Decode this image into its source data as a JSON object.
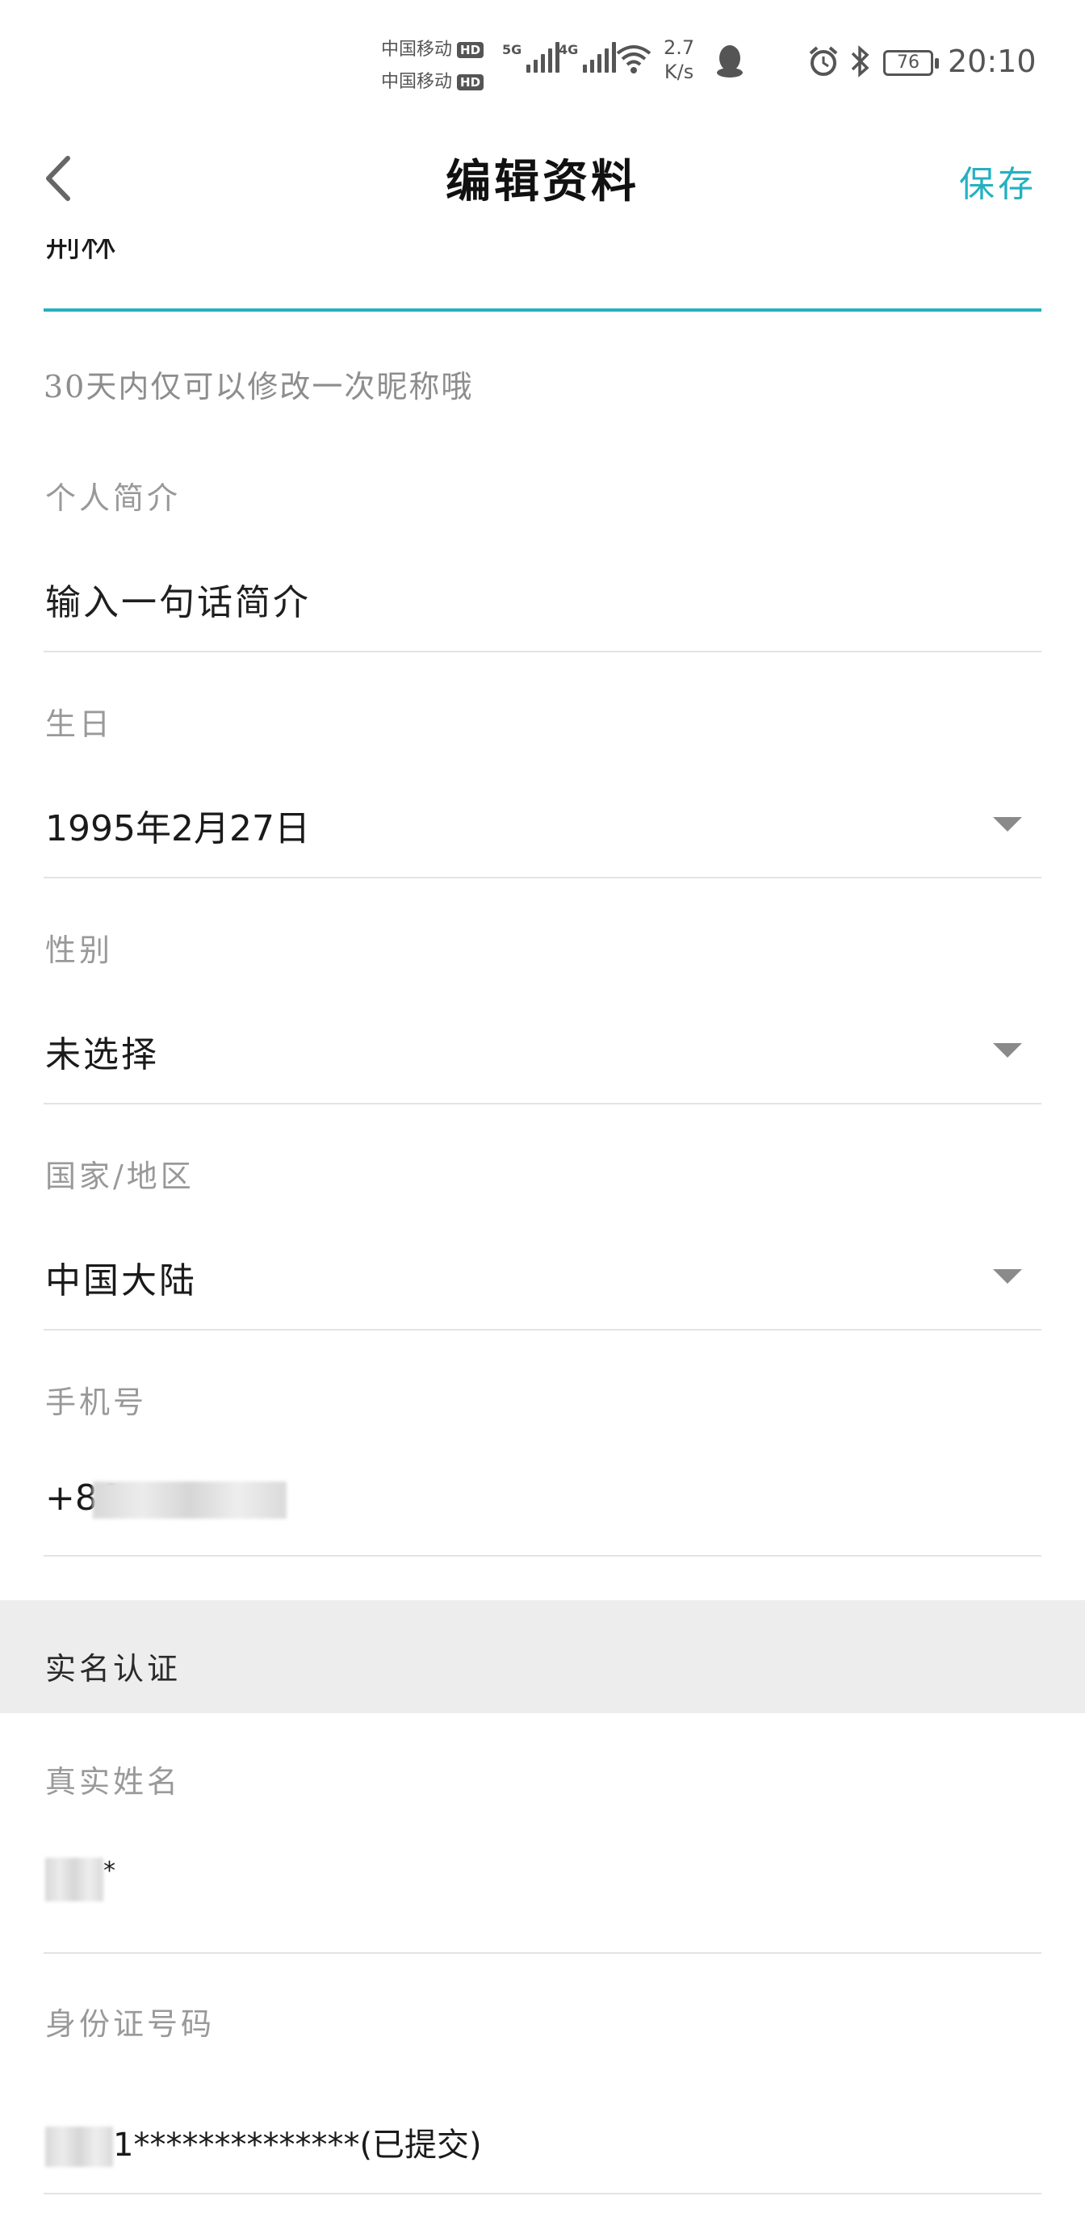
{
  "status_bar": {
    "carrier1": "中国移动",
    "carrier2": "中国移动",
    "hd": "HD",
    "sig1_label": "5G",
    "sig2_label": "4G",
    "speed_value": "2.7",
    "speed_unit": "K/s",
    "battery": "76",
    "time": "20:10"
  },
  "nav": {
    "title": "编辑资料",
    "save_label": "保存",
    "back_icon": "chevron-left-icon"
  },
  "nickname": {
    "value": "荆林",
    "hint": "30天内仅可以修改一次昵称哦"
  },
  "bio": {
    "label": "个人简介",
    "placeholder": "输入一句话简介"
  },
  "birthday": {
    "label": "生日",
    "value": "1995年2月27日"
  },
  "gender": {
    "label": "性别",
    "value": "未选择"
  },
  "region": {
    "label": "国家/地区",
    "value": "中国大陆"
  },
  "phone": {
    "label": "手机号",
    "value_prefix": "+86"
  },
  "real_name_section": {
    "title": "实名认证",
    "name_label": "真实姓名",
    "name_suffix": "*",
    "id_label": "身份证号码",
    "id_value": "1**************(已提交)"
  },
  "colors": {
    "accent": "#25b0c0",
    "label_gray": "#999999",
    "section_bg": "#ededed"
  }
}
